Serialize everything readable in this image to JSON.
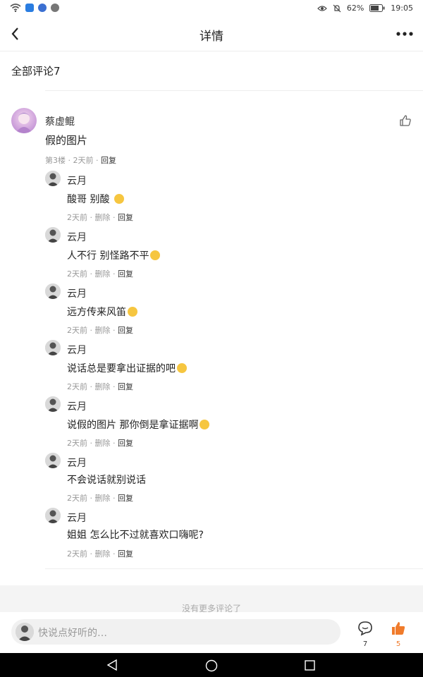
{
  "status": {
    "battery": "62%",
    "time": "19:05"
  },
  "header": {
    "title": "详情"
  },
  "comments_header": "全部评论7",
  "comment": {
    "name": "蔡虚鲲",
    "text": "假的图片",
    "floor": "第3楼",
    "time": "2天前",
    "reply_label": "回复"
  },
  "replies": [
    {
      "name": "云月",
      "text": "酸哥 别酸 ",
      "time": "2天前",
      "delete": "删除",
      "reply": "回复"
    },
    {
      "name": "云月",
      "text": "人不行 别怪路不平",
      "time": "2天前",
      "delete": "删除",
      "reply": "回复"
    },
    {
      "name": "云月",
      "text": "远方传来风笛",
      "time": "2天前",
      "delete": "删除",
      "reply": "回复"
    },
    {
      "name": "云月",
      "text": "说话总是要拿出证据的吧",
      "time": "2天前",
      "delete": "删除",
      "reply": "回复"
    },
    {
      "name": "云月",
      "text": "说假的图片 那你倒是拿证据啊",
      "time": "2天前",
      "delete": "删除",
      "reply": "回复"
    },
    {
      "name": "云月",
      "text": "不会说话就别说话",
      "time": "2天前",
      "delete": "删除",
      "reply": "回复"
    },
    {
      "name": "云月",
      "text": "姐姐 怎么比不过就喜欢口嗨呢?",
      "time": "2天前",
      "delete": "删除",
      "reply": "回复"
    }
  ],
  "no_more": "没有更多评论了",
  "bottom": {
    "placeholder": "快说点好听的…",
    "comment_count": "7",
    "like_count": "5"
  },
  "colors": {
    "accent": "#f07b2b"
  }
}
